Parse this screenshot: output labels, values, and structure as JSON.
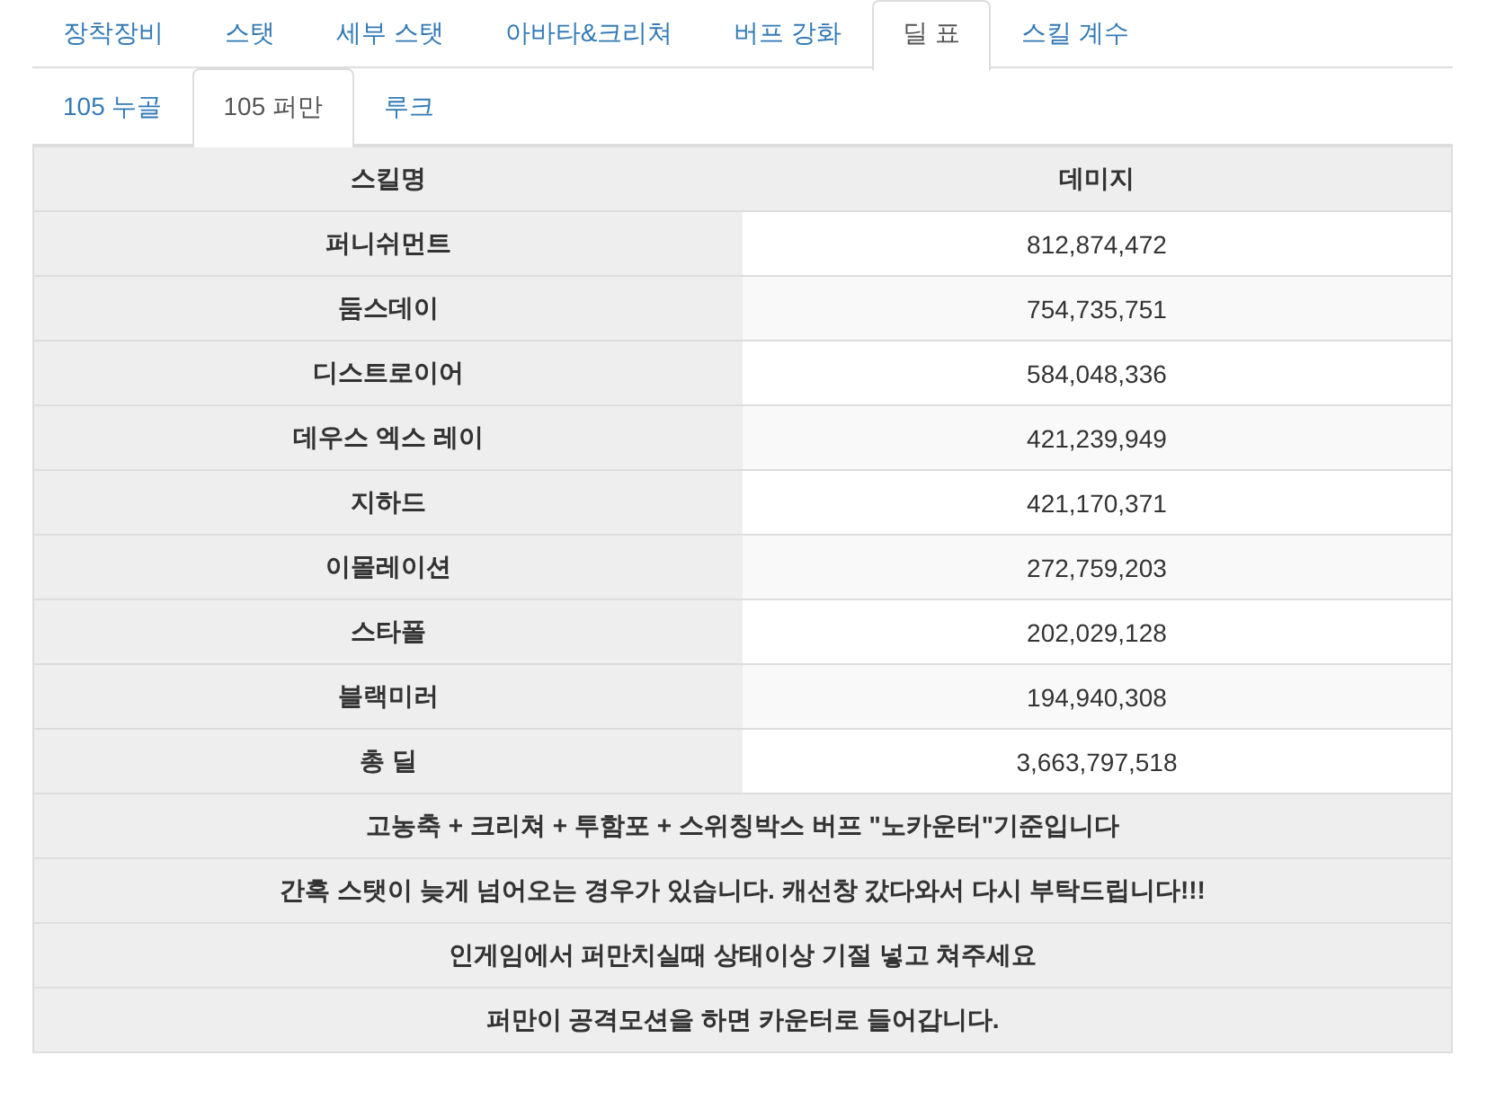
{
  "tabs": [
    {
      "label": "장착장비",
      "selected": false
    },
    {
      "label": "스탯",
      "selected": false
    },
    {
      "label": "세부 스탯",
      "selected": false
    },
    {
      "label": "아바타&크리쳐",
      "selected": false
    },
    {
      "label": "버프 강화",
      "selected": false
    },
    {
      "label": "딜 표",
      "selected": true
    },
    {
      "label": "스킬 계수",
      "selected": false
    }
  ],
  "subtabs": [
    {
      "label": "105 누골",
      "selected": false
    },
    {
      "label": "105 퍼만",
      "selected": true
    },
    {
      "label": "루크",
      "selected": false
    }
  ],
  "table": {
    "columns": [
      "스킬명",
      "데미지"
    ],
    "rows": [
      [
        "퍼니쉬먼트",
        "812,874,472"
      ],
      [
        "둠스데이",
        "754,735,751"
      ],
      [
        "디스트로이어",
        "584,048,336"
      ],
      [
        "데우스 엑스 레이",
        "421,239,949"
      ],
      [
        "지하드",
        "421,170,371"
      ],
      [
        "이몰레이션",
        "272,759,203"
      ],
      [
        "스타폴",
        "202,029,128"
      ],
      [
        "블랙미러",
        "194,940,308"
      ],
      [
        "총 딜",
        "3,663,797,518"
      ]
    ],
    "notes": [
      "고농축 **+** 크리쳐 **+** 투함포 **+** 스위칭박스 버프 \"노카운터\"기준입니다",
      "간혹 스탯이 늦게 넘어오는 경우가 있습니다. 캐선창 갔다와서 다시 부탁드립니다!!!",
      "인게임에서 퍼만치실때 상태이상 기절 넣고 쳐주세요",
      "퍼만이 공격모션을 하면 카운터로 들어갑니다."
    ]
  }
}
